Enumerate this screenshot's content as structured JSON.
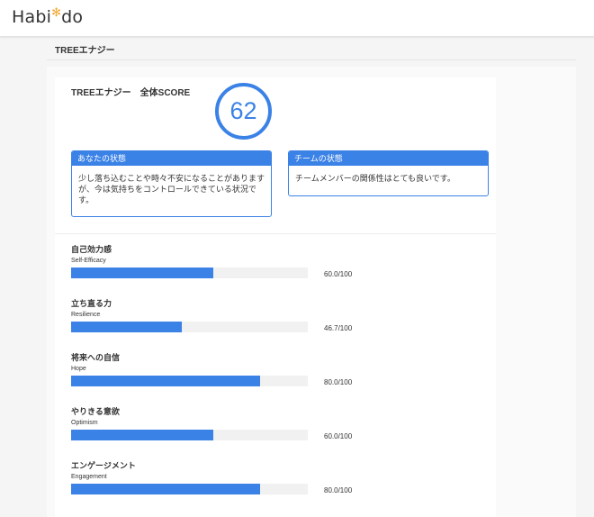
{
  "header": {
    "logo_pre": "Habi",
    "logo_post": "do"
  },
  "page": {
    "title": "TREEエナジー"
  },
  "score": {
    "label": "TREEエナジー　全体SCORE",
    "value": "62"
  },
  "status": {
    "you": {
      "title": "あなたの状態",
      "text": "少し落ち込むことや時々不安になることがありますが、今は気持ちをコントロールできている状況です。"
    },
    "team": {
      "title": "チームの状態",
      "text": "チームメンバーの関係性はとても良いです。"
    }
  },
  "metrics": [
    {
      "name": "自己効力感",
      "sub": "Self-Efficacy",
      "value": 60.0,
      "score_text": "60.0/100"
    },
    {
      "name": "立ち直る力",
      "sub": "Resilience",
      "value": 46.7,
      "score_text": "46.7/100"
    },
    {
      "name": "将来への自信",
      "sub": "Hope",
      "value": 80.0,
      "score_text": "80.0/100"
    },
    {
      "name": "やりきる意欲",
      "sub": "Optimism",
      "value": 60.0,
      "score_text": "60.0/100"
    },
    {
      "name": "エンゲージメント",
      "sub": "Engagement",
      "value": 80.0,
      "score_text": "80.0/100"
    }
  ],
  "max_value": 100,
  "colors": {
    "accent": "#3b82e6",
    "logo_star": "#f0a830"
  },
  "icons": {
    "logo": "star-icon"
  }
}
